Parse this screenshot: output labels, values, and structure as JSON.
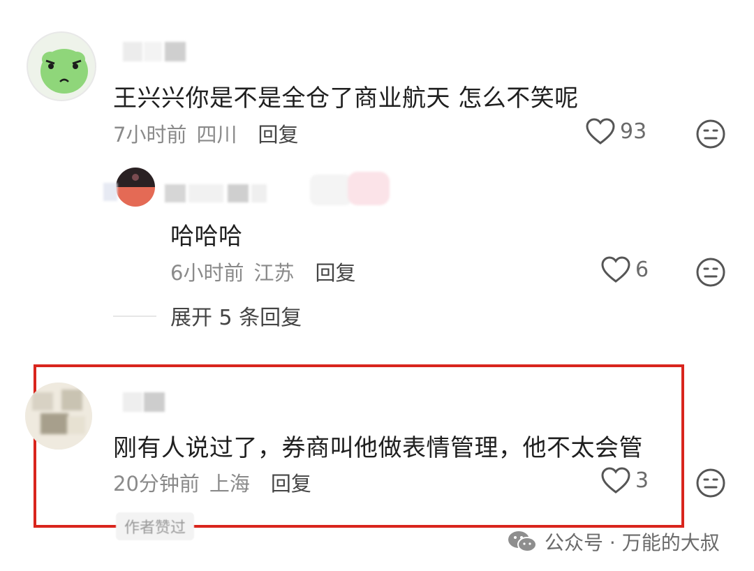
{
  "comments": [
    {
      "text": "王兴兴你是不是全仓了商业航天 怎么不笑呢",
      "time": "7小时前",
      "location": "四川",
      "reply_label": "回复",
      "likes": "93",
      "avatar_icon": "green-frog-face-icon"
    },
    {
      "text": "哈哈哈",
      "time": "6小时前",
      "location": "江苏",
      "reply_label": "回复",
      "likes": "6",
      "avatar_icon": "dark-photo-avatar-icon"
    },
    {
      "text": "刚有人说过了，券商叫他做表情管理，他不太会管",
      "time": "20分钟前",
      "location": "上海",
      "reply_label": "回复",
      "likes": "3",
      "badge": "作者赞过",
      "avatar_icon": "blurred-photo-avatar-icon"
    }
  ],
  "expand_replies": "展开 5 条回复",
  "watermark": "公众号 · 万能的大叔",
  "colors": {
    "highlight": "#d9251d",
    "meta_gray": "#8a8a8a"
  },
  "icons": [
    "heart-outline-icon",
    "neutral-face-icon",
    "wechat-icon"
  ]
}
